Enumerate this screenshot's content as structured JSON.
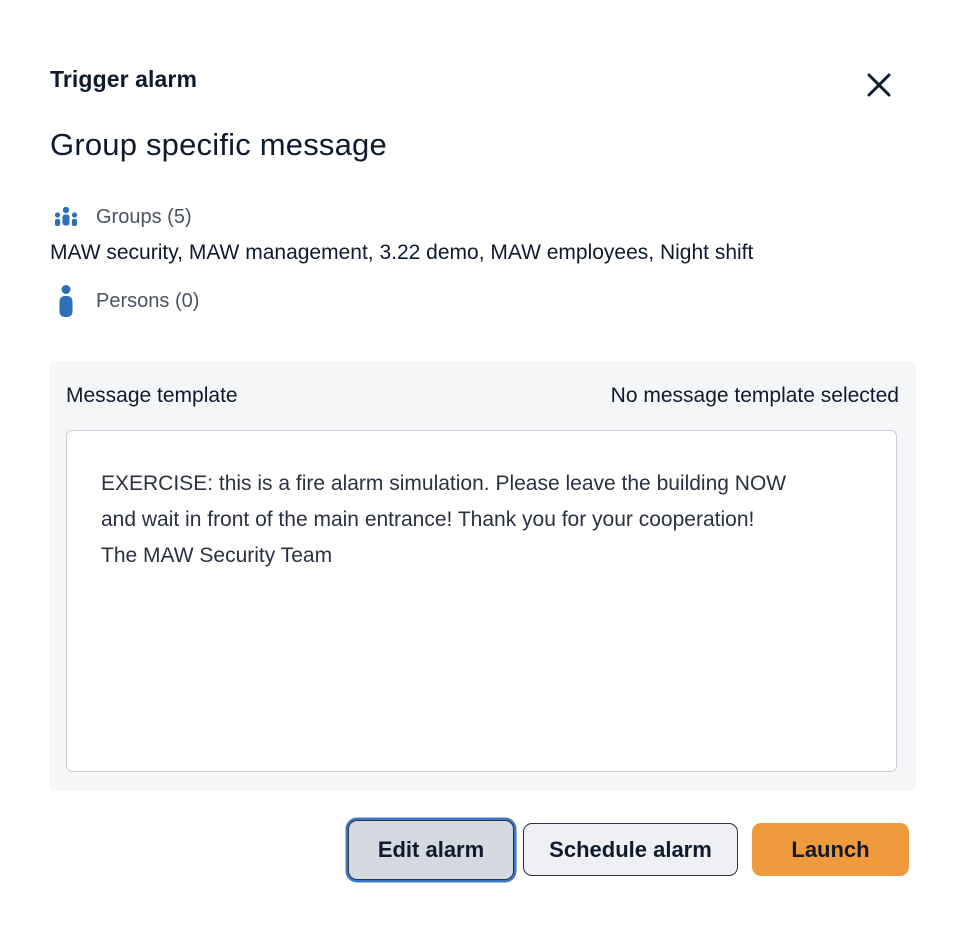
{
  "dialog": {
    "title": "Trigger alarm",
    "close_icon": "close-icon",
    "subtitle": "Group specific message"
  },
  "recipients": {
    "groups_icon": "groups-icon",
    "groups_label": "Groups",
    "groups_count": "(5)",
    "groups_list": "MAW security, MAW management, 3.22 demo, MAW employees, Night shift",
    "persons_icon": "person-icon",
    "persons_label": "Persons",
    "persons_count": "(0)"
  },
  "template": {
    "label": "Message template",
    "status": "No message template selected",
    "message": "EXERCISE: this is a fire alarm simulation. Please leave the building NOW\nand wait in front of the main entrance! Thank you for your cooperation!\nThe MAW Security Team"
  },
  "actions": {
    "edit_label": "Edit alarm",
    "schedule_label": "Schedule alarm",
    "launch_label": "Launch"
  },
  "colors": {
    "accent": "#3a78c2",
    "icon_blue": "#2f6fb8",
    "launch_orange": "#f09a3e",
    "panel_bg": "#f4f6f8",
    "text_dark": "#0f1b2d"
  }
}
